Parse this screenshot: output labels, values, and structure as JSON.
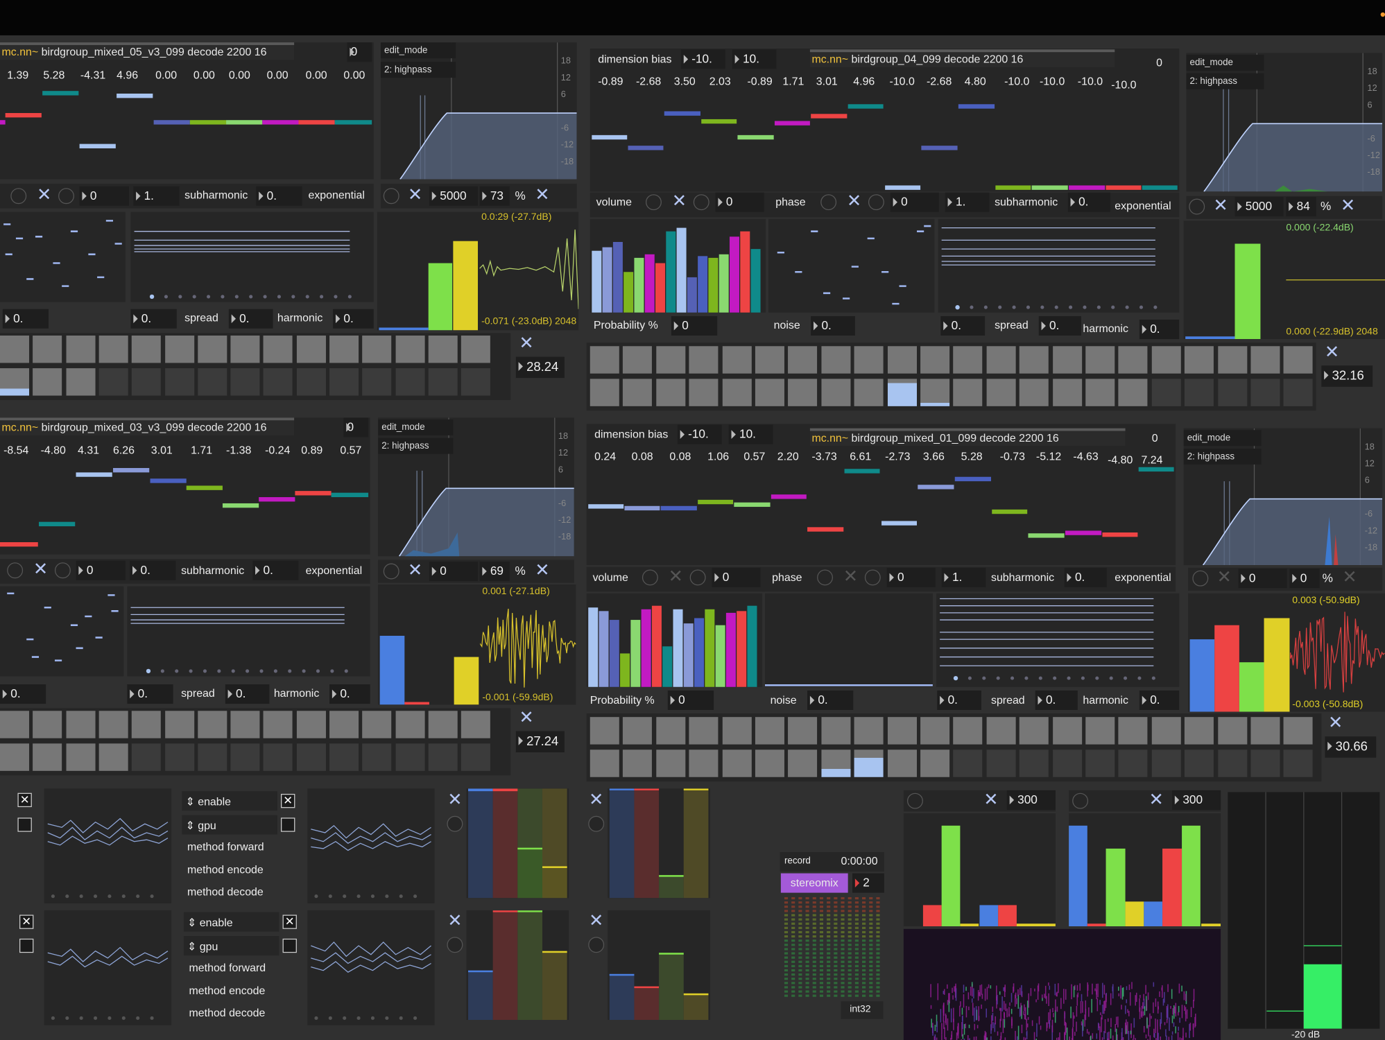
{
  "top_left": {
    "title_prefix": "mc.nn~",
    "title": " birdgroup_mixed_05_v3_099 decode 2200 16",
    "index": "0",
    "values": [
      "1.39",
      "5.28",
      "-4.31",
      "4.96",
      "0.00",
      "0.00",
      "0.00",
      "0.00",
      "0.00",
      "0.00"
    ],
    "eq_mode_label": "edit_mode",
    "eq_mode_value": "2: highpass",
    "eq_freq": "5000",
    "eq_q": "73",
    "eq_pct": "%",
    "row1_num1": "0",
    "row1_num2": "1.",
    "subharmonic_label": "subharmonic",
    "subharmonic_value": "0.",
    "exponential_label": "exponential",
    "row2_num1": "0.",
    "row2_num2": "0.",
    "spread_label": "spread",
    "spread_value": "0.",
    "harmonic_label": "harmonic",
    "harmonic_value": "0.",
    "wave_top": "0.0:29 (-27.7dB)",
    "wave_bottom": "-0.071 (-23.0dB) 2048",
    "seq_value": "28.24"
  },
  "top_right": {
    "dimension_bias_label": "dimension bias",
    "bias_min": "-10.",
    "bias_max": "10.",
    "title_prefix": "mc.nn~",
    "title": " birdgroup_04_099 decode 2200 16",
    "index": "0",
    "values": [
      "-0.89",
      "-2.68",
      "3.50",
      "2.03",
      "-0.89",
      "1.71",
      "3.01",
      "4.96",
      "-10.0",
      "-2.68",
      "4.80",
      "-10.0",
      "-10.0",
      "-10.0",
      "-10.0"
    ],
    "eq_mode_label": "edit_mode",
    "eq_mode_value": "2: highpass",
    "eq_freq": "5000",
    "eq_q": "84",
    "eq_pct": "%",
    "volume_label": "volume",
    "volume_value": "0",
    "phase_label": "phase",
    "phase_value": "0",
    "row1_num": "1.",
    "subharmonic_label": "subharmonic",
    "subharmonic_value": "0.",
    "exponential_label": "exponential",
    "probability_label": "Probability %",
    "probability_value": "0",
    "noise_label": "noise",
    "noise_value": "0.",
    "row2_num": "0.",
    "spread_label": "spread",
    "spread_value": "0.",
    "harmonic_label": "harmonic",
    "harmonic_value": "0.",
    "wave_top": "0.000 (-22.4dB)",
    "wave_bottom": "0.000 (-22.9dB) 2048",
    "seq_value": "32.16"
  },
  "mid_left": {
    "title_prefix": "mc.nn~",
    "title": " birdgroup_mixed_03_v3_099 decode 2200 16",
    "index": "0",
    "values": [
      "-8.54",
      "-4.80",
      "4.31",
      "6.26",
      "3.01",
      "1.71",
      "-1.38",
      "-0.24",
      "0.89",
      "0.57"
    ],
    "eq_mode_label": "edit_mode",
    "eq_mode_value": "2: highpass",
    "eq_freq": "0",
    "eq_q": "69",
    "eq_pct": "%",
    "row1_num1": "0",
    "row1_num2": "0.",
    "subharmonic_label": "subharmonic",
    "subharmonic_value": "0.",
    "exponential_label": "exponential",
    "row2_num1": "0.",
    "row2_num2": "0.",
    "spread_label": "spread",
    "spread_value": "0.",
    "harmonic_label": "harmonic",
    "harmonic_value": "0.",
    "wave_top": "0.001 (-27.1dB)",
    "wave_bottom": "-0.001 (-59.9dB)",
    "seq_value": "27.24"
  },
  "mid_right": {
    "dimension_bias_label": "dimension bias",
    "bias_min": "-10.",
    "bias_max": "10.",
    "title_prefix": "mc.nn~",
    "title": " birdgroup_mixed_01_099 decode 2200 16",
    "index": "0",
    "values": [
      "0.24",
      "0.08",
      "0.08",
      "1.06",
      "0.57",
      "2.20",
      "-3.73",
      "6.61",
      "-2.73",
      "3.66",
      "5.28",
      "-0.73",
      "-5.12",
      "-4.63",
      "-4.80",
      "7.24"
    ],
    "eq_mode_label": "edit_mode",
    "eq_mode_value": "2: highpass",
    "eq_freq": "0",
    "eq_q": "0",
    "eq_pct": "%",
    "volume_label": "volume",
    "volume_value": "0",
    "phase_label": "phase",
    "phase_value": "0",
    "row1_num": "1.",
    "subharmonic_label": "subharmonic",
    "subharmonic_value": "0.",
    "exponential_label": "exponential",
    "probability_label": "Probability %",
    "probability_value": "0",
    "noise_label": "noise",
    "noise_value": "0.",
    "row2_num": "0.",
    "spread_label": "spread",
    "spread_value": "0.",
    "harmonic_label": "harmonic",
    "harmonic_value": "0.",
    "wave_top": "0.003 (-50.9dB)",
    "wave_bottom": "-0.003 (-50.8dB)",
    "seq_value": "30.66"
  },
  "bottom": {
    "enable_label": "enable",
    "gpu_label": "gpu",
    "method_forward": "method forward",
    "method_encode": "method encode",
    "method_decode": "method decode",
    "record_label": "record",
    "record_time": "0:00:00",
    "stereomix_label": "stereomix",
    "stereomix_value": "2",
    "format_label": "int32",
    "scope1_value": "300",
    "scope2_value": "300",
    "meter_label": "-20 dB"
  },
  "colors": {
    "blue": "#4a7fe0",
    "red": "#ee4444",
    "green": "#7ee04a",
    "yellow": "#e0d028",
    "teal": "#0f8a8a",
    "magenta": "#c21ac2",
    "lightblue": "#a8c4f0",
    "bar_blue": "#5561b5"
  }
}
